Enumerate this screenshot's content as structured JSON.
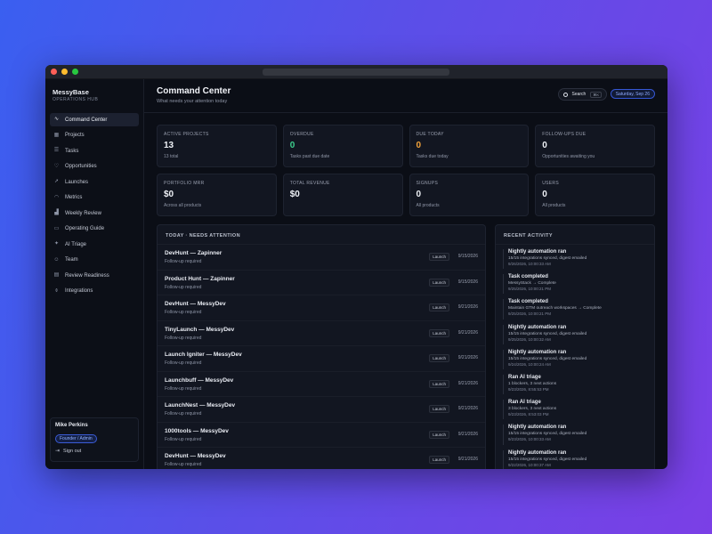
{
  "app": {
    "brand_name": "MessyBase",
    "brand_sub": "OPERATIONS HUB"
  },
  "sidebar": {
    "items": [
      {
        "label": "Command Center",
        "icon": "pulse-icon",
        "glyph": "∿",
        "active": true
      },
      {
        "label": "Projects",
        "icon": "grid-icon",
        "glyph": "▦",
        "active": false
      },
      {
        "label": "Tasks",
        "icon": "checklist-icon",
        "glyph": "☰",
        "active": false
      },
      {
        "label": "Opportunities",
        "icon": "heart-icon",
        "glyph": "♡",
        "active": false
      },
      {
        "label": "Launches",
        "icon": "rocket-icon",
        "glyph": "➚",
        "active": false
      },
      {
        "label": "Metrics",
        "icon": "gauge-icon",
        "glyph": "◠",
        "active": false
      },
      {
        "label": "Weekly Review",
        "icon": "bar-chart-icon",
        "glyph": "▟",
        "active": false
      },
      {
        "label": "Operating Guide",
        "icon": "book-icon",
        "glyph": "▭",
        "active": false
      },
      {
        "label": "AI Triage",
        "icon": "sparkle-icon",
        "glyph": "✦",
        "active": false
      },
      {
        "label": "Team",
        "icon": "users-icon",
        "glyph": "☺",
        "active": false
      },
      {
        "label": "Review Readiness",
        "icon": "clipboard-icon",
        "glyph": "▤",
        "active": false
      },
      {
        "label": "Integrations",
        "icon": "plug-icon",
        "glyph": "⌽",
        "active": false
      }
    ],
    "user": {
      "name": "Mike Perkins",
      "role": "Founder / Admin",
      "signout_label": "Sign out",
      "signout_icon": "sign-out-icon"
    }
  },
  "header": {
    "title": "Command Center",
    "subtitle": "What needs your attention today",
    "search_label": "Search",
    "search_shortcut": "⌘K",
    "date": "Saturday, Sep 26"
  },
  "stats": [
    {
      "label": "ACTIVE PROJECTS",
      "value": "13",
      "sub": "13 total",
      "color": "default"
    },
    {
      "label": "OVERDUE",
      "value": "0",
      "sub": "Tasks past due date",
      "color": "green"
    },
    {
      "label": "DUE TODAY",
      "value": "0",
      "sub": "Tasks due today",
      "color": "orange"
    },
    {
      "label": "FOLLOW-UPS DUE",
      "value": "0",
      "sub": "Opportunities awaiting you",
      "color": "default"
    },
    {
      "label": "PORTFOLIO MRR",
      "value": "$0",
      "sub": "Across all products",
      "color": "default"
    },
    {
      "label": "TOTAL REVENUE",
      "value": "$0",
      "sub": "",
      "color": "default"
    },
    {
      "label": "SIGNUPS",
      "value": "0",
      "sub": "All products",
      "color": "default"
    },
    {
      "label": "USERS",
      "value": "0",
      "sub": "All products",
      "color": "default"
    }
  ],
  "attention": {
    "title": "TODAY · NEEDS ATTENTION",
    "rows": [
      {
        "title": "DevHunt — Zapinner",
        "sub": "Follow-up required",
        "tag": "Launch",
        "date": "9/15/2026"
      },
      {
        "title": "Product Hunt — Zapinner",
        "sub": "Follow-up required",
        "tag": "Launch",
        "date": "9/15/2026"
      },
      {
        "title": "DevHunt — MessyDev",
        "sub": "Follow-up required",
        "tag": "Launch",
        "date": "9/21/2026"
      },
      {
        "title": "TinyLaunch — MessyDev",
        "sub": "Follow-up required",
        "tag": "Launch",
        "date": "9/21/2026"
      },
      {
        "title": "Launch Igniter — MessyDev",
        "sub": "Follow-up required",
        "tag": "Launch",
        "date": "9/21/2026"
      },
      {
        "title": "Launchbuff — MessyDev",
        "sub": "Follow-up required",
        "tag": "Launch",
        "date": "9/21/2026"
      },
      {
        "title": "LaunchNest — MessyDev",
        "sub": "Follow-up required",
        "tag": "Launch",
        "date": "9/21/2026"
      },
      {
        "title": "1000tools — MessyDev",
        "sub": "Follow-up required",
        "tag": "Launch",
        "date": "9/21/2026"
      },
      {
        "title": "DevHunt — MessyDev",
        "sub": "Follow-up required",
        "tag": "Launch",
        "date": "9/21/2026"
      }
    ]
  },
  "activity": {
    "title": "RECENT ACTIVITY",
    "items": [
      {
        "title": "Nightly automation ran",
        "detail": "15/15 integrations synced, digest emailed",
        "time": "9/26/2026, 10:00:33 AM"
      },
      {
        "title": "Task completed",
        "detail": "MessyStack → Complete",
        "time": "9/25/2026, 10:00:21 PM"
      },
      {
        "title": "Task completed",
        "detail": "Maintain GTM outreach workspaces → Complete",
        "time": "9/25/2026, 10:00:21 PM"
      },
      {
        "title": "Nightly automation ran",
        "detail": "15/15 integrations synced, digest emailed",
        "time": "9/25/2026, 10:00:32 AM"
      },
      {
        "title": "Nightly automation ran",
        "detail": "15/15 integrations synced, digest emailed",
        "time": "9/24/2026, 10:00:24 AM"
      },
      {
        "title": "Ran AI triage",
        "detail": "1 blockers, 3 next actions",
        "time": "9/23/2026, 8:55:53 PM"
      },
      {
        "title": "Ran AI triage",
        "detail": "3 blockers, 3 next actions",
        "time": "9/23/2026, 8:53:03 PM"
      },
      {
        "title": "Nightly automation ran",
        "detail": "15/15 integrations synced, digest emailed",
        "time": "9/23/2026, 10:00:33 AM"
      },
      {
        "title": "Nightly automation ran",
        "detail": "15/15 integrations synced, digest emailed",
        "time": "9/22/2026, 10:00:37 AM"
      }
    ]
  },
  "colors": {
    "accent": "#3a5bd6",
    "overdue": "#3ecf8e",
    "due_today": "#f2a23a"
  }
}
